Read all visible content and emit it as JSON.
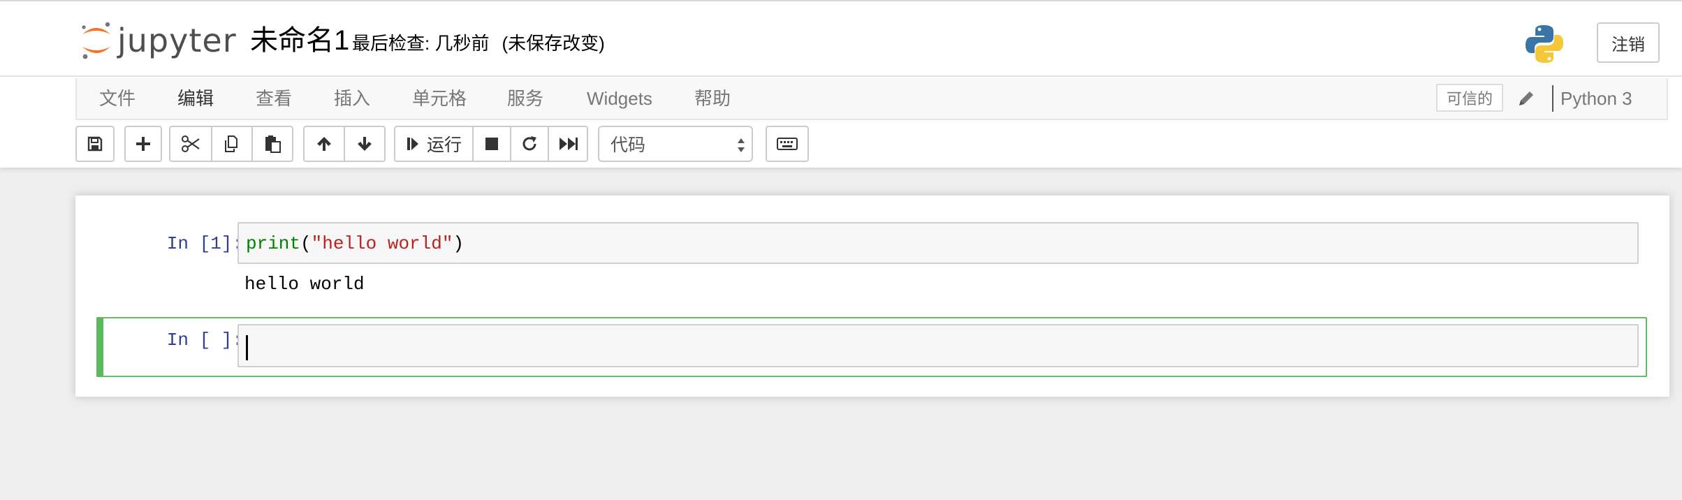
{
  "header": {
    "logo_text": "jupyter",
    "notebook_title": "未命名1",
    "checkpoint": "最后检查: 几秒前",
    "autosave_status": "(未保存改变)",
    "logout_label": "注销"
  },
  "menubar": {
    "items": [
      {
        "label": "文件"
      },
      {
        "label": "编辑"
      },
      {
        "label": "查看"
      },
      {
        "label": "插入"
      },
      {
        "label": "单元格"
      },
      {
        "label": "服务"
      },
      {
        "label": "Widgets"
      },
      {
        "label": "帮助"
      }
    ],
    "trusted_label": "可信的",
    "kernel_name": "Python 3"
  },
  "toolbar": {
    "run_label": "运行",
    "cell_type": "代码"
  },
  "cells": [
    {
      "prompt": "In [1]:",
      "code_fn": "print",
      "code_open": "(",
      "code_string": "\"hello world\"",
      "code_close": ")",
      "output": "hello world"
    },
    {
      "prompt": "In [ ]:",
      "code": ""
    }
  ],
  "colors": {
    "accent_orange": "#f37626",
    "prompt_blue": "#303f9f",
    "selected_cell_green": "#5cb85c",
    "keyword_green": "#008000",
    "string_red": "#ba2121"
  }
}
